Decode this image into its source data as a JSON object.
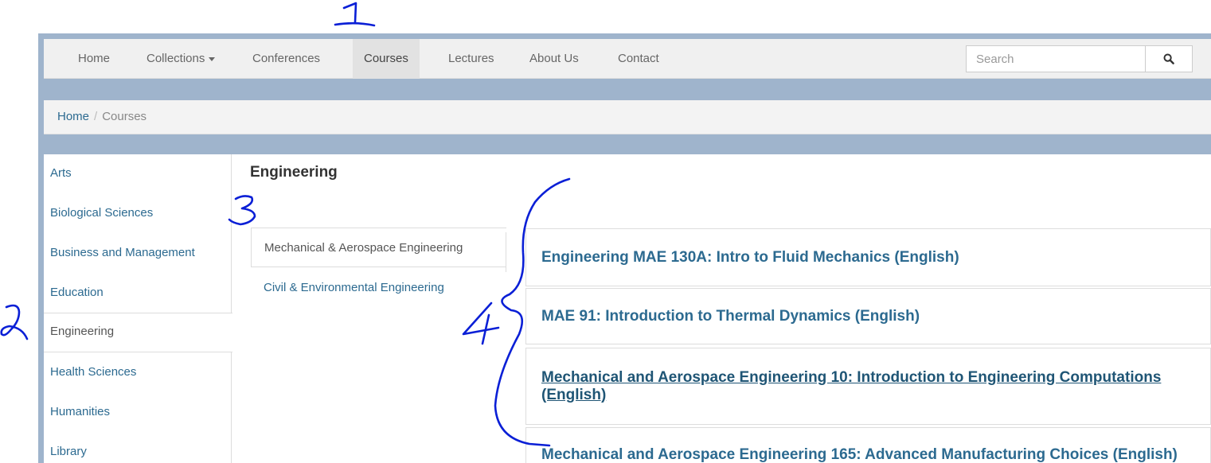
{
  "nav": {
    "items": [
      {
        "label": "Home"
      },
      {
        "label": "Collections"
      },
      {
        "label": "Conferences"
      },
      {
        "label": "Courses"
      },
      {
        "label": "Lectures"
      },
      {
        "label": "About Us"
      },
      {
        "label": "Contact"
      }
    ],
    "active": "Courses",
    "search": {
      "placeholder": "Search",
      "value": ""
    }
  },
  "breadcrumb": {
    "home": "Home",
    "separator": "/",
    "current": "Courses"
  },
  "categories": {
    "items": [
      {
        "label": "Arts"
      },
      {
        "label": "Biological Sciences"
      },
      {
        "label": "Business and Management"
      },
      {
        "label": "Education"
      },
      {
        "label": "Engineering"
      },
      {
        "label": "Health Sciences"
      },
      {
        "label": "Humanities"
      },
      {
        "label": "Library"
      }
    ],
    "active": "Engineering"
  },
  "section": {
    "title": "Engineering",
    "subcategories": [
      {
        "label": "Mechanical & Aerospace Engineering"
      },
      {
        "label": "Civil & Environmental Engineering"
      }
    ],
    "active_subcategory": "Mechanical & Aerospace Engineering"
  },
  "courses": [
    {
      "title": "Engineering MAE 130A: Intro to Fluid Mechanics (English)"
    },
    {
      "title": "MAE 91: Introduction to Thermal Dynamics (English)"
    },
    {
      "title": "Mechanical and Aerospace Engineering 10: Introduction to Engineering Computations (English)"
    },
    {
      "title": "Mechanical and Aerospace Engineering 165: Advanced Manufacturing Choices (English)"
    }
  ],
  "annotations": {
    "marks": [
      "1",
      "2",
      "3",
      "4"
    ],
    "ink_color": "#0a1fd6"
  },
  "colors": {
    "link": "#2c6a90",
    "frame": "#9fb4cc",
    "navbar": "#f0f0f0"
  },
  "icons": {
    "search": "search-icon",
    "dropdown": "caret-down-icon"
  }
}
